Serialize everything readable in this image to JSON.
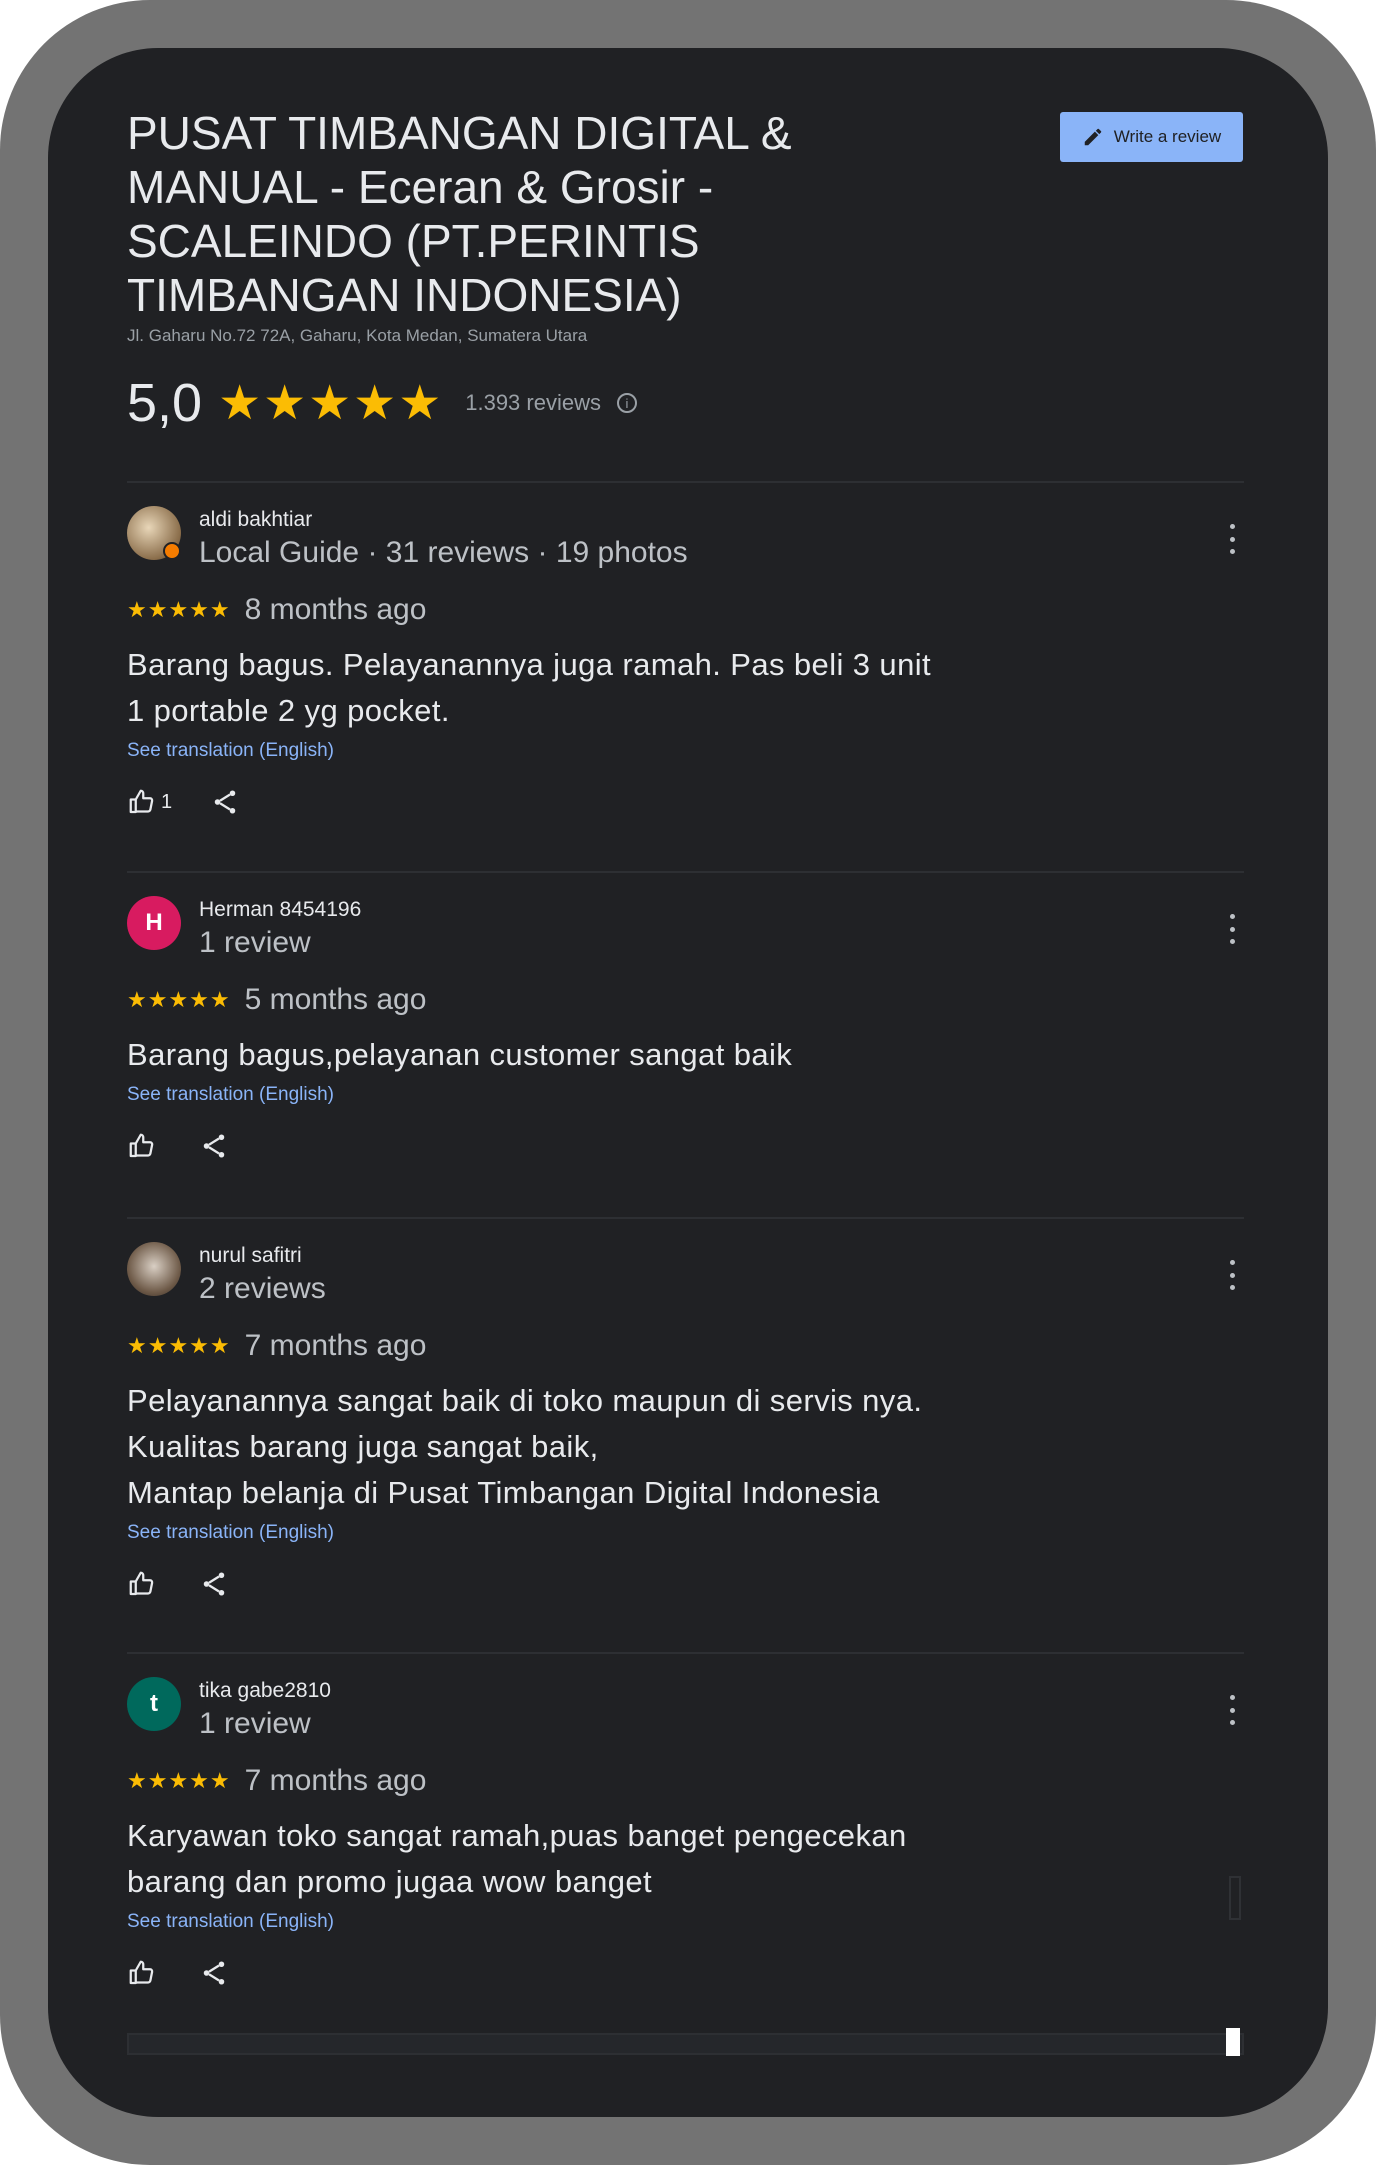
{
  "business": {
    "title": "PUSAT TIMBANGAN DIGITAL & MANUAL - Eceran & Grosir - SCALEINDO (PT.PERINTIS TIMBANGAN INDONESIA)",
    "address": "Jl. Gaharu No.72 72A, Gaharu, Kota Medan, Sumatera Utara",
    "rating": "5,0",
    "rating_stars": "★★★★★",
    "review_count": "1.393 reviews",
    "write_review_label": "Write a review"
  },
  "colors": {
    "background": "#202124",
    "frame": "#737373",
    "star": "#fbbc04",
    "link": "#8ab4f8",
    "text": "#e8eaed"
  },
  "reviews": [
    {
      "name": "aldi bakhtiar",
      "meta": "Local Guide · 31 reviews · 19 photos",
      "avatar_type": "photo",
      "local_guide": true,
      "stars": "★★★★★",
      "time": "8 months ago",
      "text_lines": [
        "Barang bagus. Pelayanannya juga ramah. Pas beli 3 unit",
        "1 portable 2 yg pocket."
      ],
      "translate": "See translation (English)",
      "likes": "1"
    },
    {
      "name": "Herman 8454196",
      "meta": "1 review",
      "avatar_letter": "H",
      "avatar_color": "#d81b60",
      "stars": "★★★★★",
      "time": "5 months ago",
      "text_lines": [
        "Barang bagus,pelayanan customer sangat baik"
      ],
      "translate": "See translation (English)",
      "likes": ""
    },
    {
      "name": "nurul safitri",
      "meta": "2 reviews",
      "avatar_type": "photo",
      "stars": "★★★★★",
      "time": "7 months ago",
      "text_lines": [
        "Pelayanannya sangat baik di toko maupun di servis nya.",
        "Kualitas barang juga sangat baik,",
        "Mantap belanja di Pusat Timbangan Digital Indonesia"
      ],
      "translate": "See translation (English)",
      "likes": ""
    },
    {
      "name": "tika gabe2810",
      "meta": "1 review",
      "avatar_letter": "t",
      "avatar_color": "#00695c",
      "stars": "★★★★★",
      "time": "7 months ago",
      "text_lines": [
        "Karyawan toko sangat ramah,puas banget pengecekan",
        "barang dan promo jugaa wow banget"
      ],
      "translate": "See translation (English)",
      "likes": ""
    }
  ]
}
